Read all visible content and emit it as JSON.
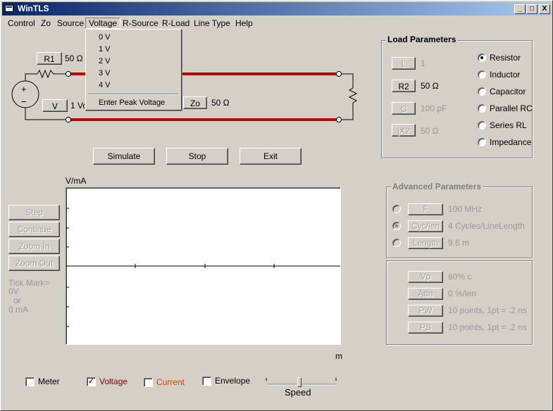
{
  "window": {
    "title": "WinTLS",
    "minimize": "_",
    "maximize": "□",
    "close": "X"
  },
  "menu": [
    "Control",
    "Zo",
    "Source",
    "Voltage",
    "R-Source",
    "R-Load",
    "Line Type",
    "Help"
  ],
  "voltage_menu": {
    "items": [
      "0 V",
      "1 V",
      "2 V",
      "3 V",
      "4 V"
    ],
    "peak": "Enter  Peak Voltage"
  },
  "circuit": {
    "r1_button": "R1",
    "r1_value": "50 Ω",
    "v_button": "V",
    "v_value": "1 Vo",
    "zo_button": "Zo",
    "zo_value": "50 Ω",
    "source_plus": "+",
    "source_minus": "−"
  },
  "controls": {
    "simulate": "Simulate",
    "stop": "Stop",
    "exit": "Exit"
  },
  "side_buttons": {
    "step": "Step",
    "continue": "Continue",
    "zoom_in": "Zoom In",
    "zoom_out": "Zoom Out"
  },
  "tick_mark": {
    "line1": "Tick Mark=",
    "line2": "0V",
    "line3": "or",
    "line4": "0 mA"
  },
  "plot": {
    "y_label": "V/mA",
    "x_label": "m"
  },
  "load_params": {
    "title": "Load Parameters",
    "l_button": "L",
    "l_value": "1",
    "r2_button": "R2",
    "r2_value": "50 Ω",
    "c_button": "C",
    "c_value": "100 pF",
    "jx2_button": "jX2",
    "jx2_value": "50 Ω",
    "types": [
      "Resistor",
      "Inductor",
      "Capacitor",
      "Parallel RC",
      "Series RL",
      "Impedance"
    ],
    "selected": "Resistor"
  },
  "advanced": {
    "title": "Advanced Parameters",
    "f_button": "F",
    "f_value": "100 MHz",
    "cyc_button": "Cyc/len",
    "cyc_value": "4 Cycles/LineLength",
    "length_button": "Length",
    "length_value": "9.6 m",
    "vp_button": "Vp",
    "vp_value": "80% c",
    "attn_button": "Attn",
    "attn_value": "0 %/len",
    "pw_button": "PW",
    "pw_value": "10 points, 1pt = .2 ns",
    "ps_button": "PS",
    "ps_value": "10 points, 1pt = .2 ns"
  },
  "bottom": {
    "meter": "Meter",
    "meter_checked": false,
    "voltage": "Voltage",
    "voltage_checked": true,
    "current": "Current",
    "current_checked": false,
    "envelope": "Envelope",
    "envelope_checked": false,
    "speed": "Speed"
  },
  "colors": {
    "line": "#c00000",
    "voltage_label": "#800000",
    "current_label": "#d04000",
    "titlebar": "#0a246a"
  }
}
